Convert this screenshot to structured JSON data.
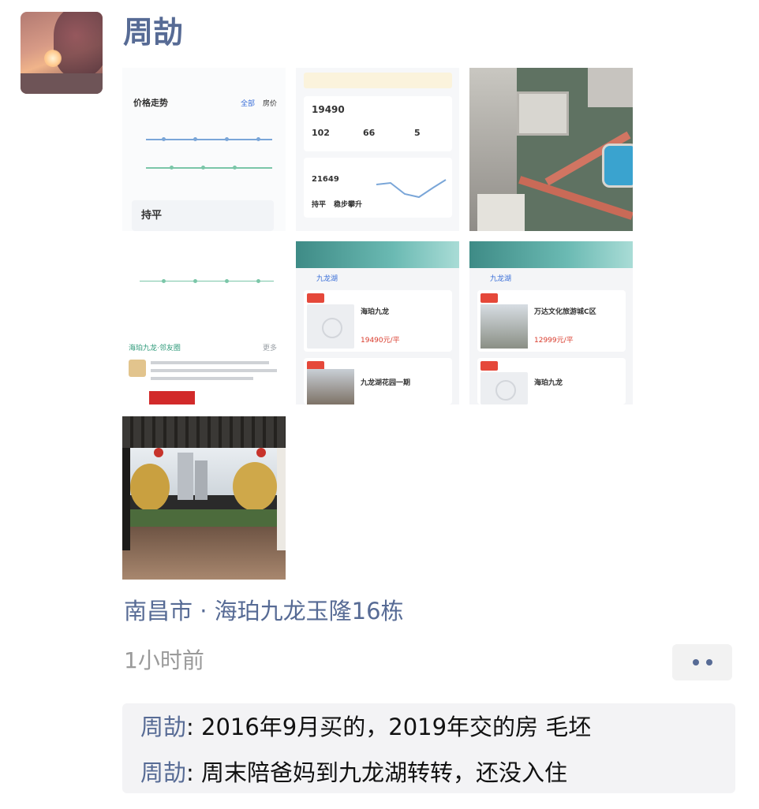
{
  "post": {
    "username": "周劼",
    "location": "南昌市 · 海珀九龙玉隆16栋",
    "time": "1小时前"
  },
  "comments": [
    {
      "author": "周劼",
      "text": ": 2016年9月买的，2019年交的房 毛坯"
    },
    {
      "author": "周劼",
      "text": ": 周末陪爸妈到九龙湖转转，还没入住"
    }
  ],
  "thumbs": {
    "t1": {
      "section": "价格走势",
      "tab_a": "全部",
      "tab_b": "房价",
      "name": "持平"
    },
    "t2": {
      "price": "19490",
      "n1": "102",
      "n2": "66",
      "n3": "5",
      "price2": "21649",
      "status_a": "持平",
      "status_b": "稳步攀升"
    },
    "t4": {
      "section": "海珀九龙·邻友圈",
      "more": "更多"
    },
    "t5": {
      "tab": "九龙湖",
      "title_a": "海珀九龙",
      "price_a": "19490元/平",
      "title_b": "九龙湖花园一期"
    },
    "t6": {
      "tab": "九龙湖",
      "title_a": "万达文化旅游城C区",
      "price_a": "12999元/平",
      "title_b": "海珀九龙"
    }
  }
}
